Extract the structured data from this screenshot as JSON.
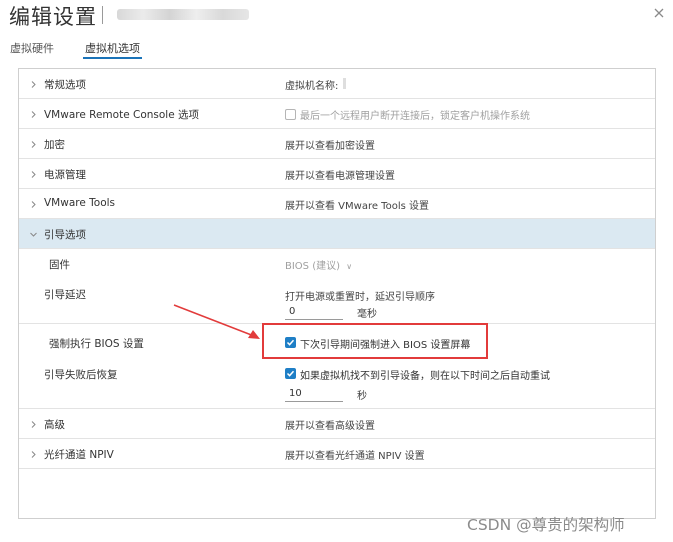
{
  "dialog": {
    "title": "编辑设置"
  },
  "tabs": [
    {
      "label": "虚拟硬件"
    },
    {
      "label": "虚拟机选项"
    }
  ],
  "rows": {
    "general": {
      "label": "常规选项",
      "value": "虚拟机名称:"
    },
    "vmrc": {
      "label": "VMware Remote Console 选项",
      "value": "最后一个远程用户断开连接后，锁定客户机操作系统"
    },
    "encrypt": {
      "label": "加密",
      "value": "展开以查看加密设置"
    },
    "power": {
      "label": "电源管理",
      "value": "展开以查看电源管理设置"
    },
    "tools": {
      "label": "VMware Tools",
      "value": "展开以查看 VMware Tools 设置"
    },
    "boot": {
      "label": "引导选项"
    },
    "firmware": {
      "label": "固件",
      "value": "BIOS (建议)",
      "caret": "∨"
    },
    "boot_delay": {
      "label": "引导延迟",
      "desc": "打开电源或重置时，延迟引导顺序",
      "input": "0",
      "unit": "毫秒"
    },
    "force_bios": {
      "label": "强制执行 BIOS 设置",
      "value": "下次引导期间强制进入 BIOS 设置屏幕"
    },
    "boot_fail": {
      "label": "引导失败后恢复",
      "value": "如果虚拟机找不到引导设备，则在以下时间之后自动重试",
      "input": "10",
      "unit": "秒"
    },
    "advanced": {
      "label": "高级",
      "value": "展开以查看高级设置"
    },
    "npiv": {
      "label": "光纤通道 NPIV",
      "value": "展开以查看光纤通道 NPIV 设置"
    }
  },
  "watermark": "CSDN @尊贵的架构师",
  "colors": {
    "accent": "#1f7fc6",
    "selected_row": "#dbe9f2",
    "annotation": "#e23b3b"
  }
}
